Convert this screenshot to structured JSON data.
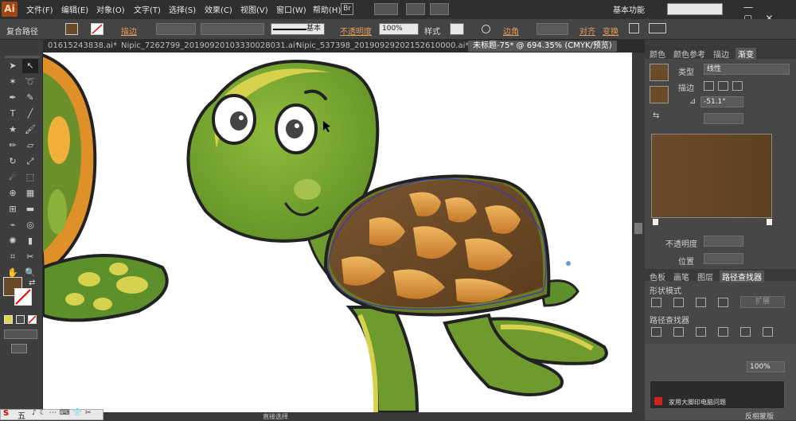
{
  "app": {
    "logo": "Ai"
  },
  "menu": [
    "文件(F)",
    "编辑(E)",
    "对象(O)",
    "文字(T)",
    "选择(S)",
    "效果(C)",
    "视图(V)",
    "窗口(W)",
    "帮助(H)"
  ],
  "bridge": "Br",
  "workspace": "基本功能",
  "window_buttons": "—▢✕",
  "control": {
    "selection_type": "复合路径",
    "stroke_label": "描边",
    "stroke_profile": "基本",
    "opacity_label": "不透明度",
    "opacity_value": "100%",
    "style_label": "样式",
    "corner_label": "边角",
    "align_label": "对齐",
    "transform_label": "变换"
  },
  "tabs": [
    "01615243838.ai*",
    "Nipic_7262799_20190920103330028031.ai*",
    "Nipic_537398_20190929202152610000.ai*",
    "未标题-75* @ 694.35% (CMYK/预览)"
  ],
  "gradient_panel": {
    "tabs": [
      "颜色",
      "颜色参考",
      "描边",
      "渐变"
    ],
    "type_label": "类型",
    "type_value": "线性",
    "stroke_label": "描边",
    "angle_value": "-51.1°",
    "opacity_label": "不透明度",
    "position_label": "位置",
    "start_color": "#6b4a2a",
    "end_color": "#5e4020"
  },
  "pathfinder_panel": {
    "tabs": [
      "色板",
      "画笔",
      "图层",
      "路径查找器"
    ],
    "shape_modes_label": "形状模式",
    "expand_label": "扩展",
    "pathfinders_label": "路径查找器"
  },
  "bottom_panel": {
    "percent": "100%",
    "label": "反相蒙版"
  },
  "status": {
    "tool": "直接选择"
  },
  "taskbar": {
    "ime": "五"
  },
  "watermark_notification": "家用大脚印电脑问题"
}
